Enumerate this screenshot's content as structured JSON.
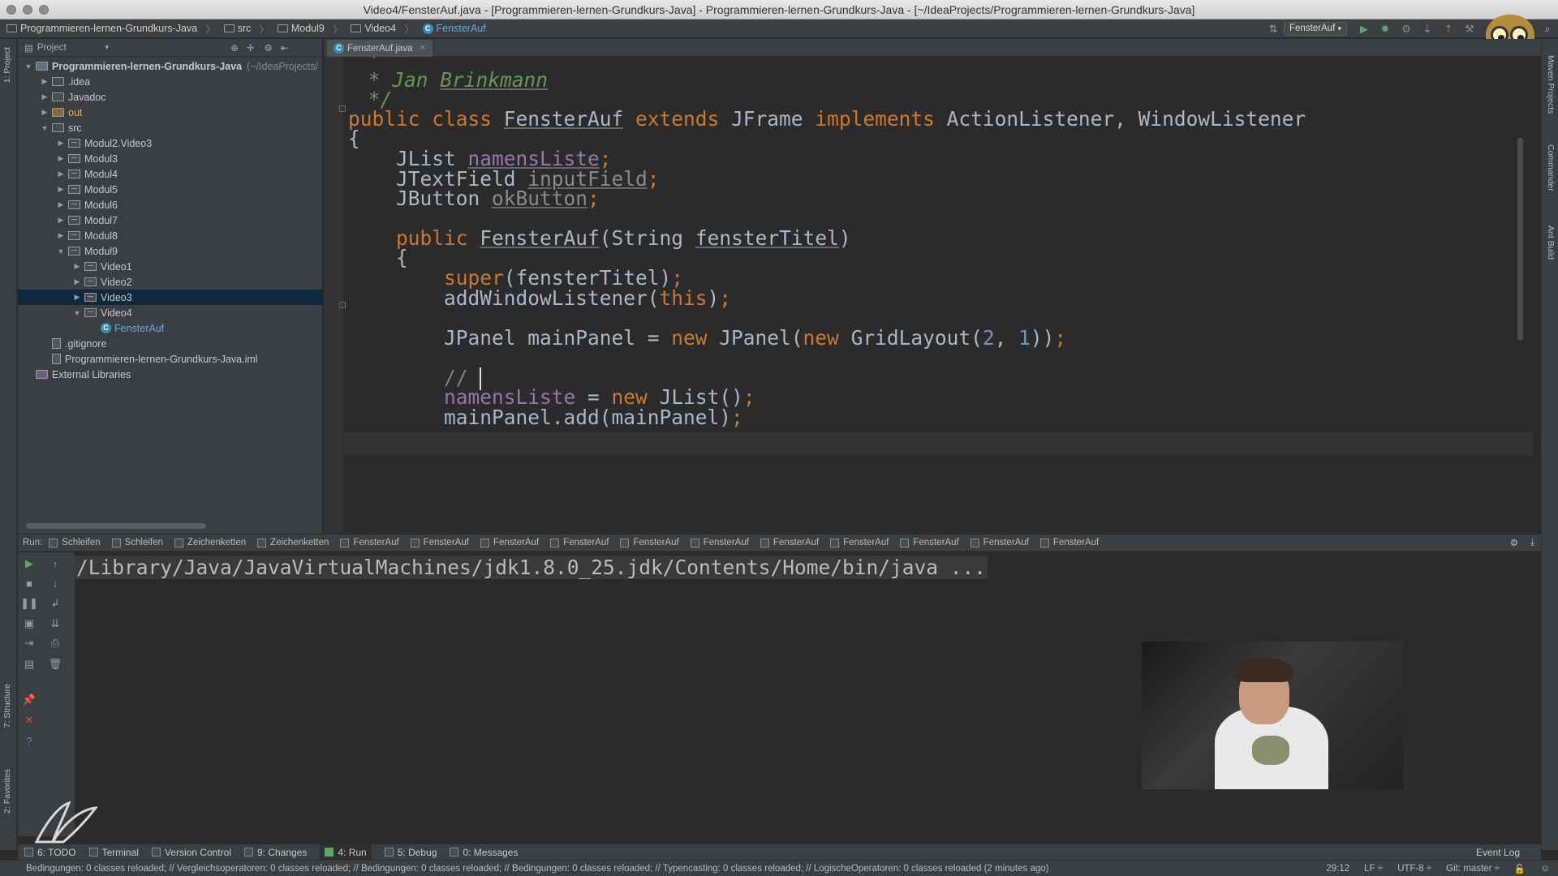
{
  "window": {
    "title": "Video4/FensterAuf.java - [Programmieren-lernen-Grundkurs-Java] - Programmieren-lernen-Grundkurs-Java - [~/IdeaProjects/Programmieren-lernen-Grundkurs-Java]"
  },
  "breadcrumbs": [
    "Programmieren-lernen-Grundkurs-Java",
    "src",
    "Modul9",
    "Video4",
    "FensterAuf"
  ],
  "run_config": "FensterAuf",
  "project_panel": {
    "header": "Project",
    "tree": [
      {
        "label": "Programmieren-lernen-Grundkurs-Java",
        "suffix": "(~/IdeaProjects/",
        "level": 0,
        "expanded": true,
        "type": "module"
      },
      {
        "label": ".idea",
        "level": 1,
        "expanded": false,
        "type": "folder"
      },
      {
        "label": "Javadoc",
        "level": 1,
        "expanded": false,
        "type": "folder"
      },
      {
        "label": "out",
        "level": 1,
        "expanded": false,
        "type": "folder-out"
      },
      {
        "label": "src",
        "level": 1,
        "expanded": true,
        "type": "folder"
      },
      {
        "label": "Modul2.Video3",
        "level": 2,
        "expanded": false,
        "type": "package"
      },
      {
        "label": "Modul3",
        "level": 2,
        "expanded": false,
        "type": "package"
      },
      {
        "label": "Modul4",
        "level": 2,
        "expanded": false,
        "type": "package"
      },
      {
        "label": "Modul5",
        "level": 2,
        "expanded": false,
        "type": "package"
      },
      {
        "label": "Modul6",
        "level": 2,
        "expanded": false,
        "type": "package"
      },
      {
        "label": "Modul7",
        "level": 2,
        "expanded": false,
        "type": "package"
      },
      {
        "label": "Modul8",
        "level": 2,
        "expanded": false,
        "type": "package"
      },
      {
        "label": "Modul9",
        "level": 2,
        "expanded": true,
        "type": "package"
      },
      {
        "label": "Video1",
        "level": 3,
        "expanded": false,
        "type": "package"
      },
      {
        "label": "Video2",
        "level": 3,
        "expanded": false,
        "type": "package"
      },
      {
        "label": "Video3",
        "level": 3,
        "expanded": false,
        "type": "package",
        "selected": true
      },
      {
        "label": "Video4",
        "level": 3,
        "expanded": true,
        "type": "package"
      },
      {
        "label": "FensterAuf",
        "level": 4,
        "type": "class"
      },
      {
        "label": ".gitignore",
        "level": 1,
        "type": "file"
      },
      {
        "label": "Programmieren-lernen-Grundkurs-Java.iml",
        "level": 1,
        "type": "file"
      },
      {
        "label": "External Libraries",
        "level": 0,
        "type": "libraries"
      }
    ]
  },
  "editor": {
    "tab": "FensterAuf.java",
    "cursor_position": "29:12"
  },
  "run_panel": {
    "label": "Run:",
    "tabs": [
      "Schleifen",
      "Schleifen",
      "Zeichenketten",
      "Zeichenketten",
      "FensterAuf",
      "FensterAuf",
      "FensterAuf",
      "FensterAuf",
      "FensterAuf",
      "FensterAuf",
      "FensterAuf",
      "FensterAuf",
      "FensterAuf",
      "FensterAuf",
      "FensterAuf"
    ],
    "console": "/Library/Java/JavaVirtualMachines/jdk1.8.0_25.jdk/Contents/Home/bin/java ..."
  },
  "left_strip": {
    "project": "1: Project",
    "structure": "7: Structure",
    "favorites": "2: Favorites"
  },
  "right_strip": {
    "maven": "Maven Projects",
    "commander": "Commander",
    "ant": "Ant Build"
  },
  "bottom_tools": [
    {
      "label": "6: TODO"
    },
    {
      "label": "Terminal"
    },
    {
      "label": "Version Control"
    },
    {
      "label": "9: Changes"
    },
    {
      "label": "4: Run",
      "active": true
    },
    {
      "label": "5: Debug"
    },
    {
      "label": "0: Messages"
    }
  ],
  "event_log": "Event Log",
  "status": {
    "message": "Bedingungen: 0 classes reloaded; // Vergleichsoperatoren: 0 classes reloaded; // Bedingungen: 0 classes reloaded; // Bedingungen: 0 classes reloaded; // Typencasting: 0 classes reloaded; // LogischeOperatoren: 0 classes reloaded (2 minutes ago)",
    "position": "29:12",
    "line_sep": "LF ÷",
    "encoding": "UTF-8 ÷",
    "vcs": "Git: master ÷"
  },
  "colors": {
    "selection": "#0d293e",
    "keyword": "#cc7832",
    "field": "#9876aa",
    "number": "#6897bb",
    "doc_comment": "#629755",
    "run_green": "#59a869"
  }
}
